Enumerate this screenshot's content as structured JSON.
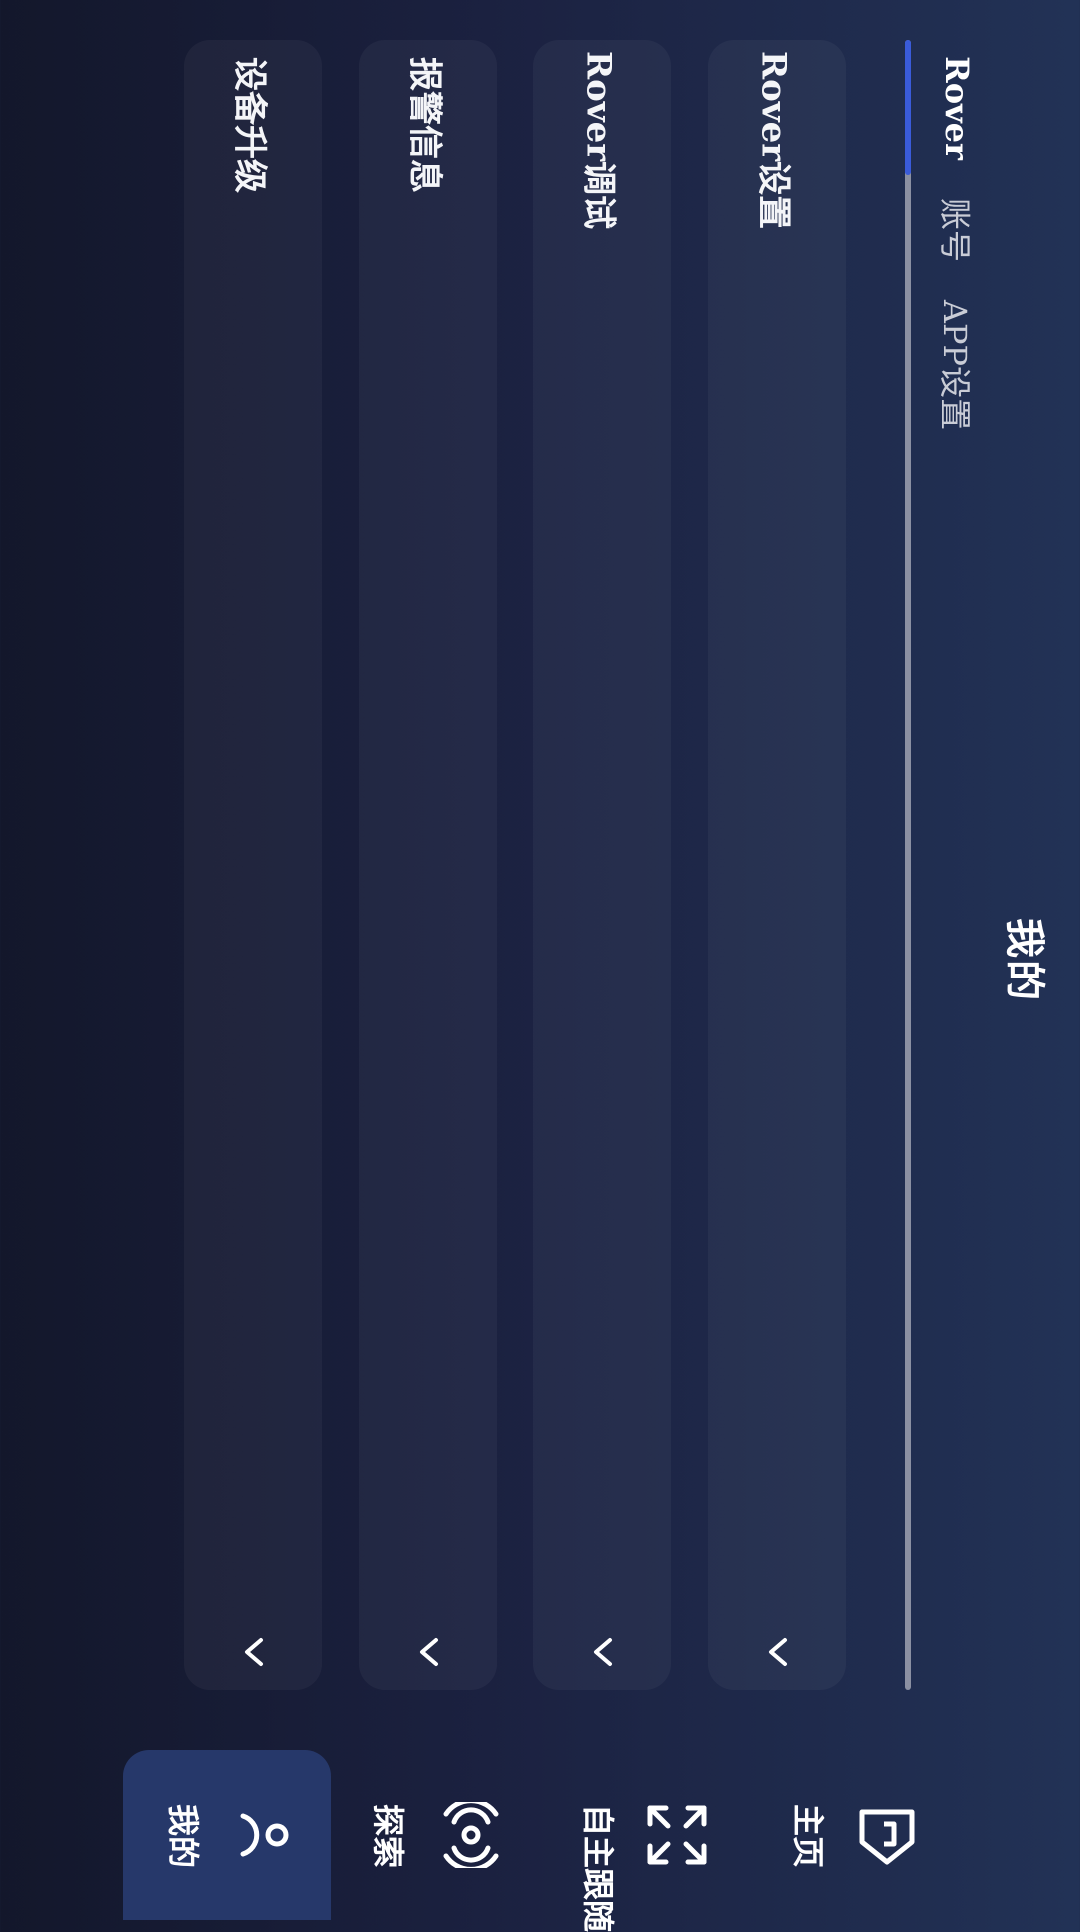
{
  "header": {
    "title": "我的"
  },
  "tabs": [
    {
      "label": "Rover",
      "active": true
    },
    {
      "label": "账号",
      "active": false
    },
    {
      "label": "APP设置",
      "active": false
    }
  ],
  "cards": [
    {
      "label": "Rover设置",
      "icon": "chevron-down-icon"
    },
    {
      "label": "Rover调试",
      "icon": "chevron-down-icon"
    },
    {
      "label": "报警信息",
      "icon": "chevron-down-icon"
    },
    {
      "label": "设备升级",
      "icon": "chevron-down-icon"
    }
  ],
  "bottom_nav": [
    {
      "label": "主页",
      "icon": "home-icon"
    },
    {
      "label": "自主跟随",
      "icon": "expand-arrows-icon"
    },
    {
      "label": "探索",
      "icon": "broadcast-icon"
    },
    {
      "label": "我的",
      "icon": "user-icon",
      "active": true
    }
  ],
  "colors": {
    "accent": "#3a5bd9",
    "active_nav_bg": "#26386a",
    "tab_track": "#8b90a2",
    "bg_start": "#13172b",
    "bg_end": "#223256"
  }
}
